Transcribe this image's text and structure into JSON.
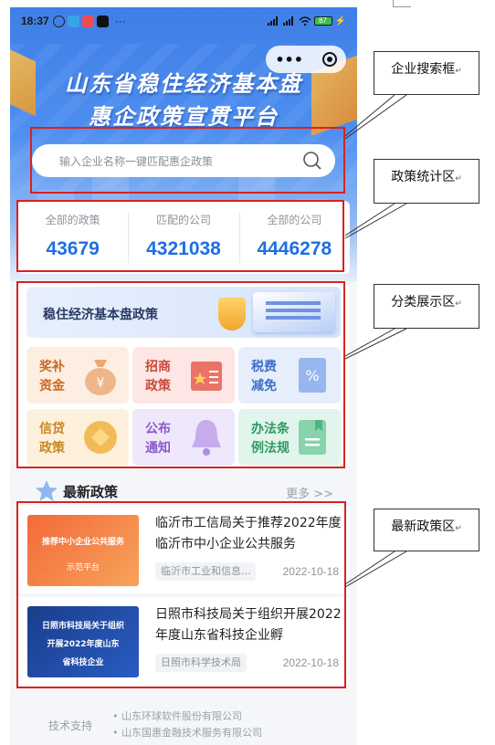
{
  "status_bar": {
    "time": "18:37",
    "dots": "···",
    "battery": "87"
  },
  "capsule": {
    "menu": "•••"
  },
  "hero": {
    "title_line1": "山东省稳住经济基本盘",
    "title_line2": "惠企政策宣贯平台"
  },
  "search": {
    "placeholder": "输入企业名称一键匹配惠企政策"
  },
  "stats": [
    {
      "label": "全部的政策",
      "value": "43679"
    },
    {
      "label": "匹配的公司",
      "value": "4321038"
    },
    {
      "label": "全部的公司",
      "value": "4446278"
    }
  ],
  "category": {
    "banner": "稳住经济基本盘政策",
    "tiles": [
      {
        "line1": "奖补",
        "line2": "资金",
        "icon": "money-bag-icon",
        "color": "#c96a24",
        "bg": "#fdeee2"
      },
      {
        "line1": "招商",
        "line2": "政策",
        "icon": "book-icon",
        "color": "#c94a3a",
        "bg": "#fde6e3"
      },
      {
        "line1": "税费",
        "line2": "减免",
        "icon": "percent-doc-icon",
        "color": "#3f6fc9",
        "bg": "#e6eefc"
      },
      {
        "line1": "信贷",
        "line2": "政策",
        "icon": "coin-icon",
        "color": "#c9861e",
        "bg": "#fdf1dc"
      },
      {
        "line1": "公布",
        "line2": "通知",
        "icon": "bell-icon",
        "color": "#8a5ac9",
        "bg": "#efe7fb"
      },
      {
        "line1": "办法条",
        "line2": "例法规",
        "icon": "bookmark-book-icon",
        "color": "#2f9a64",
        "bg": "#e2f5ec"
      }
    ]
  },
  "latest": {
    "title": "最新政策",
    "more": "更多 >>",
    "items": [
      {
        "title": "临沂市工信局关于推荐2022年度临沂市中小企业公共服务",
        "source": "临沂市工业和信息…",
        "date": "2022-10-18",
        "thumb_line1": "推荐中小企业公共服务",
        "thumb_line2": "示范平台"
      },
      {
        "title": "日照市科技局关于组织开展2022年度山东省科技企业孵",
        "source": "日照市科学技术局",
        "date": "2022-10-18",
        "thumb_line1": "日照市科技局关于组织",
        "thumb_line2": "开展2022年度山东",
        "thumb_line3": "省科技企业"
      }
    ]
  },
  "footer": {
    "support_label": "技术支持",
    "companies": [
      "山东环球软件股份有限公司",
      "山东国惠金融技术服务有限公司"
    ]
  },
  "annotations": {
    "search_box": "企业搜索框",
    "stats_area": "政策统计区",
    "category_area": "分类展示区",
    "latest_area": "最新政策区",
    "return_mark": "↵"
  },
  "colors": {
    "accent": "#1f6fe0",
    "annotation_red": "#d9221f"
  }
}
